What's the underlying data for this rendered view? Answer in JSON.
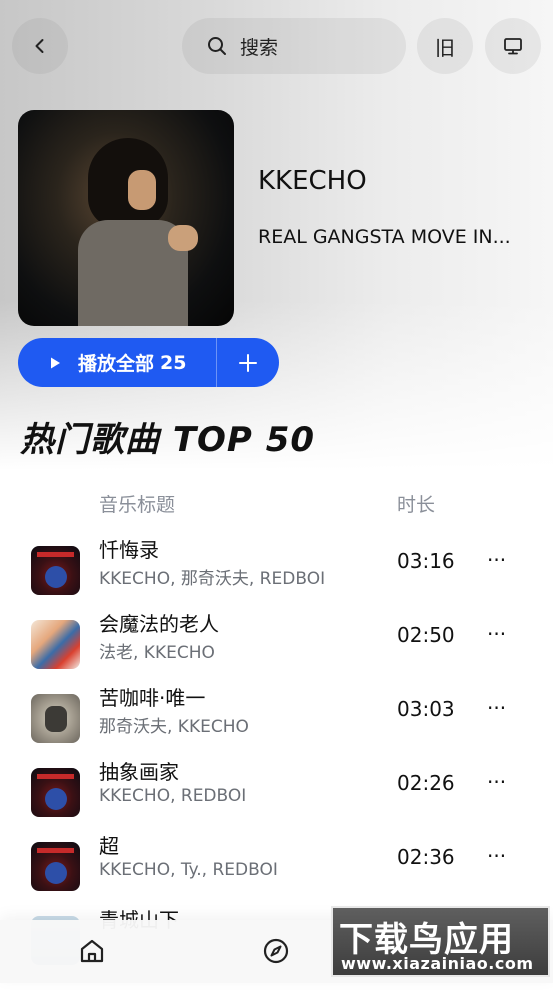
{
  "topbar": {
    "search_label": "搜索",
    "old_label": "旧"
  },
  "artist": {
    "name": "KKECHO",
    "album": "REAL GANGSTA MOVE IN..."
  },
  "play_all": {
    "label": "播放全部",
    "count": "25"
  },
  "section": {
    "title": "热门歌曲 TOP 50"
  },
  "columns": {
    "title": "音乐标题",
    "duration": "时长"
  },
  "songs": [
    {
      "title": "忏悔录",
      "artists": "KKECHO, 那奇沃夫, REDBOI",
      "duration": "03:16",
      "more": "···"
    },
    {
      "title": "会魔法的老人",
      "artists": "法老, KKECHO",
      "duration": "02:50",
      "more": "···"
    },
    {
      "title": "苦咖啡·唯一",
      "artists": "那奇沃夫, KKECHO",
      "duration": "03:03",
      "more": "···"
    },
    {
      "title": "抽象画家",
      "artists": "KKECHO, REDBOI",
      "duration": "02:26",
      "more": "···"
    },
    {
      "title": "超",
      "artists": "KKECHO, Ty., REDBOI",
      "duration": "02:36",
      "more": "···"
    },
    {
      "title": "青城山下",
      "artists": "",
      "duration": "",
      "more": ""
    }
  ],
  "watermark": {
    "main": "下载鸟应用",
    "url": "www.xiazainiao.com"
  },
  "icons": {
    "back": "chevron-left-icon",
    "search": "search-icon",
    "screen": "monitor-icon",
    "play": "play-icon",
    "add": "plus-icon",
    "home": "home-icon",
    "explore": "compass-icon"
  },
  "colors": {
    "accent": "#1f5af2",
    "secondary_text": "#6b6f76",
    "header_text": "#8a8f99"
  }
}
